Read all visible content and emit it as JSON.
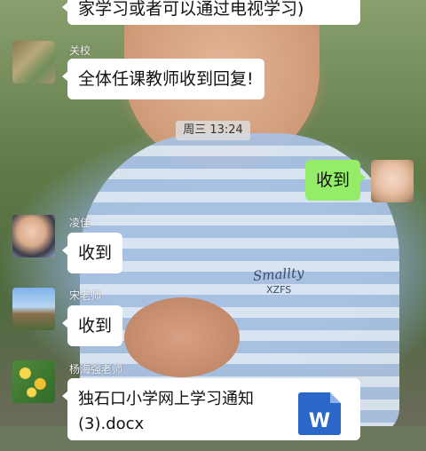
{
  "background": {
    "shirt_brand": "Smallty",
    "shirt_code": "XZFS"
  },
  "messages": [
    {
      "text": "家学习或者可以通过电视学习)"
    },
    {
      "sender": "关校",
      "text": "全体任课教师收到回复!"
    },
    {
      "time": "周三 13:24"
    },
    {
      "text": "收到"
    },
    {
      "sender": "凌佳",
      "text": "收到"
    },
    {
      "sender": "宋老师",
      "text": "收到"
    },
    {
      "sender": "杨海强老师",
      "file_name_line1": "独石口小学网上学习通知",
      "file_name_line2": "(3).docx",
      "file_icon_letter": "W"
    }
  ],
  "colors": {
    "outgoing_bubble": "#95ec69",
    "incoming_bubble": "#ffffff",
    "word_icon": "#2b67c9"
  },
  "icons": [
    "word-document-icon"
  ]
}
